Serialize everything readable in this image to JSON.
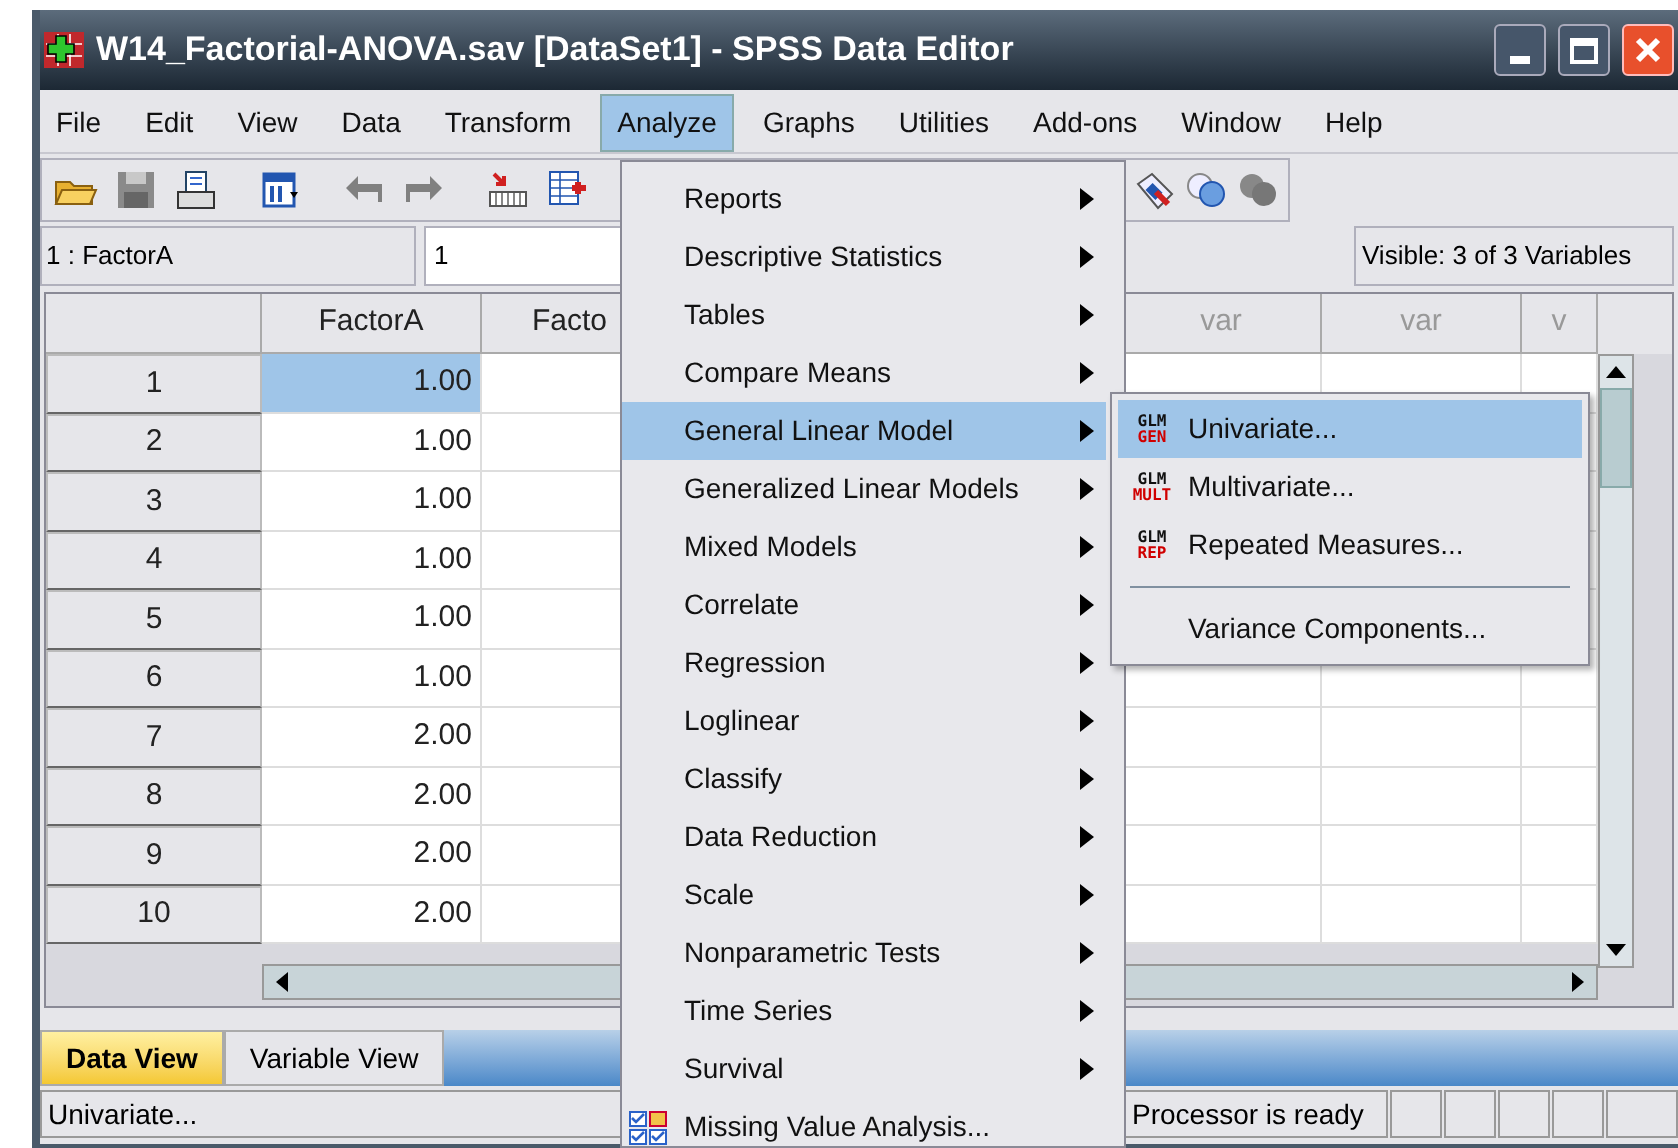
{
  "window": {
    "title": "W14_Factorial-ANOVA.sav [DataSet1] - SPSS Data Editor"
  },
  "menu_bar": [
    {
      "label": "File",
      "selected": false
    },
    {
      "label": "Edit",
      "selected": false
    },
    {
      "label": "View",
      "selected": false
    },
    {
      "label": "Data",
      "selected": false
    },
    {
      "label": "Transform",
      "selected": false
    },
    {
      "label": "Analyze",
      "selected": true
    },
    {
      "label": "Graphs",
      "selected": false
    },
    {
      "label": "Utilities",
      "selected": false
    },
    {
      "label": "Add-ons",
      "selected": false
    },
    {
      "label": "Window",
      "selected": false
    },
    {
      "label": "Help",
      "selected": false
    }
  ],
  "cell_editor": {
    "cell": "1 : FactorA",
    "value": "1",
    "visible": "Visible: 3 of 3 Variables"
  },
  "grid": {
    "columns": [
      {
        "header": "FactorA"
      },
      {
        "header": "Facto"
      },
      {
        "header": "var"
      },
      {
        "header": "var"
      },
      {
        "header": "v"
      }
    ],
    "rows": [
      {
        "number": "1",
        "cells": [
          {
            "value": "1.00",
            "selected": true
          }
        ]
      },
      {
        "number": "2",
        "cells": [
          {
            "value": "1.00",
            "selected": false
          }
        ]
      },
      {
        "number": "3",
        "cells": [
          {
            "value": "1.00",
            "selected": false
          }
        ]
      },
      {
        "number": "4",
        "cells": [
          {
            "value": "1.00",
            "selected": false
          }
        ]
      },
      {
        "number": "5",
        "cells": [
          {
            "value": "1.00",
            "selected": false
          }
        ]
      },
      {
        "number": "6",
        "cells": [
          {
            "value": "1.00",
            "selected": false
          }
        ]
      },
      {
        "number": "7",
        "cells": [
          {
            "value": "2.00",
            "selected": false
          }
        ]
      },
      {
        "number": "8",
        "cells": [
          {
            "value": "2.00",
            "selected": false
          }
        ]
      },
      {
        "number": "9",
        "cells": [
          {
            "value": "2.00",
            "selected": false
          }
        ]
      },
      {
        "number": "10",
        "cells": [
          {
            "value": "2.00",
            "selected": false
          }
        ]
      }
    ]
  },
  "view_tabs": [
    {
      "label": "Data View",
      "selected": true
    },
    {
      "label": "Variable View",
      "selected": false
    }
  ],
  "status_bar": {
    "message": "Univariate...",
    "processor": "Processor is ready"
  },
  "analyze_menu": [
    {
      "label": "Reports",
      "kind": "submenu",
      "selected": false
    },
    {
      "label": "Descriptive Statistics",
      "kind": "submenu",
      "selected": false
    },
    {
      "label": "Tables",
      "kind": "submenu",
      "selected": false
    },
    {
      "label": "Compare Means",
      "kind": "submenu",
      "selected": false
    },
    {
      "label": "General Linear Model",
      "kind": "submenu",
      "selected": true
    },
    {
      "label": "Generalized Linear Models",
      "kind": "submenu",
      "selected": false
    },
    {
      "label": "Mixed Models",
      "kind": "submenu",
      "selected": false
    },
    {
      "label": "Correlate",
      "kind": "submenu",
      "selected": false
    },
    {
      "label": "Regression",
      "kind": "submenu",
      "selected": false
    },
    {
      "label": "Loglinear",
      "kind": "submenu",
      "selected": false
    },
    {
      "label": "Classify",
      "kind": "submenu",
      "selected": false
    },
    {
      "label": "Data Reduction",
      "kind": "submenu",
      "selected": false
    },
    {
      "label": "Scale",
      "kind": "submenu",
      "selected": false
    },
    {
      "label": "Nonparametric Tests",
      "kind": "submenu",
      "selected": false
    },
    {
      "label": "Time Series",
      "kind": "submenu",
      "selected": false
    },
    {
      "label": "Survival",
      "kind": "submenu",
      "selected": false
    },
    {
      "label": "Missing Value Analysis...",
      "kind": "action",
      "selected": false
    }
  ],
  "glm_submenu": [
    {
      "label": "Univariate...",
      "kind": "action",
      "badge": [
        "GLM",
        "GEN"
      ],
      "selected": true
    },
    {
      "label": "Multivariate...",
      "kind": "action",
      "badge": [
        "GLM",
        "MULT"
      ],
      "selected": false
    },
    {
      "label": "Repeated Measures...",
      "kind": "action",
      "badge": [
        "GLM",
        "REP"
      ],
      "selected": false
    },
    {
      "kind": "separator"
    },
    {
      "label": "Variance Components...",
      "kind": "action",
      "selected": false
    }
  ]
}
